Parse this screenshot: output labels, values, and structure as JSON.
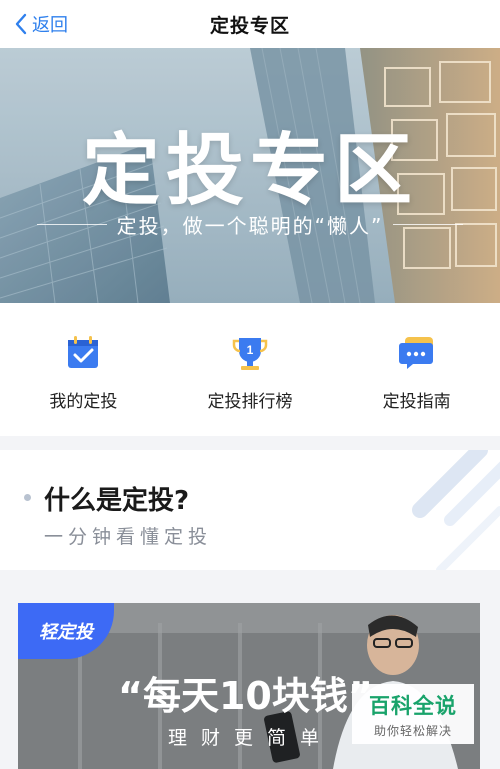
{
  "navbar": {
    "back_label": "返回",
    "title": "定投专区"
  },
  "hero": {
    "title": "定投专区",
    "subtitle": "定投，做一个聪明的“懒人”"
  },
  "shortcuts": [
    {
      "label": "我的定投",
      "icon": "calendar-check-icon",
      "color": "#3b7bf0"
    },
    {
      "label": "定投排行榜",
      "icon": "trophy-icon",
      "color": "#3b7bf0"
    },
    {
      "label": "定投指南",
      "icon": "chat-bubble-icon",
      "color": "#3b7bf0"
    }
  ],
  "whatis": {
    "title": "什么是定投?",
    "subtitle": "一分钟看懂定投"
  },
  "promo": {
    "badge": "轻定投",
    "title": "“每天10块钱”",
    "subtitle": "理财更简单"
  },
  "watermark": {
    "brand": "百科全说",
    "tagline": "助你轻松解决"
  },
  "colors": {
    "accent": "#2f80ed",
    "icon_blue": "#3b7bf0",
    "badge_blue": "#3d6af5",
    "watermark_green": "#19a36b"
  }
}
